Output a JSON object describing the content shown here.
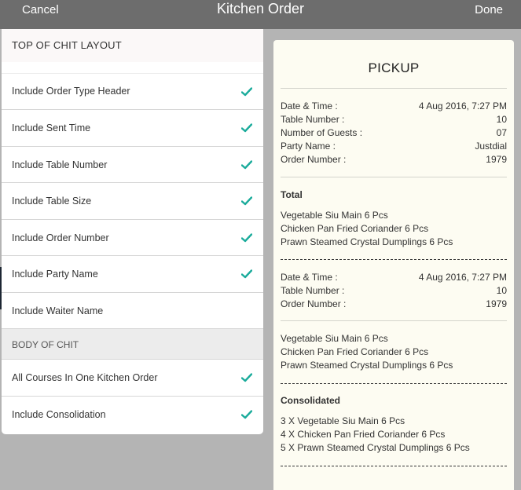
{
  "header": {
    "cancel": "Cancel",
    "title": "Kitchen Order",
    "done": "Done"
  },
  "settings": {
    "top_section": "TOP OF CHIT LAYOUT",
    "top_rows": [
      {
        "label": "Include Order Type Header",
        "checked": true
      },
      {
        "label": "Include Sent Time",
        "checked": true
      },
      {
        "label": "Include Table Number",
        "checked": true
      },
      {
        "label": "Include Table Size",
        "checked": true
      },
      {
        "label": "Include Order Number",
        "checked": true
      },
      {
        "label": "Include Party Name",
        "checked": true
      },
      {
        "label": "Include Waiter Name",
        "checked": false
      }
    ],
    "body_section": "BODY OF CHIT",
    "body_rows": [
      {
        "label": "All Courses In One Kitchen Order",
        "checked": true
      },
      {
        "label": "Include Consolidation",
        "checked": true
      }
    ],
    "check_color": "#1aab9b"
  },
  "preview": {
    "title": "PICKUP",
    "block1": [
      {
        "k": "Date & Time :",
        "v": "4 Aug 2016, 7:27 PM"
      },
      {
        "k": "Table Number :",
        "v": "10"
      },
      {
        "k": "Number of Guests :",
        "v": "07"
      },
      {
        "k": "Party Name :",
        "v": "Justdial"
      },
      {
        "k": "Order Number :",
        "v": "1979"
      }
    ],
    "total_label": "Total",
    "items1": [
      "Vegetable Siu Main 6 Pcs",
      "Chicken Pan Fried Coriander 6 Pcs",
      "Prawn Steamed Crystal Dumplings 6 Pcs"
    ],
    "block2": [
      {
        "k": "Date & Time :",
        "v": "4 Aug 2016, 7:27 PM"
      },
      {
        "k": "Table Number :",
        "v": "10"
      },
      {
        "k": "Order Number :",
        "v": "1979"
      }
    ],
    "items2": [
      "Vegetable Siu Main 6 Pcs",
      "Chicken Pan Fried Coriander 6 Pcs",
      "Prawn Steamed Crystal Dumplings 6 Pcs"
    ],
    "consolidated_label": "Consolidated",
    "consolidated": [
      "3 X Vegetable Siu Main 6 Pcs",
      "4 X Chicken Pan Fried Coriander 6 Pcs",
      "5 X Prawn Steamed Crystal Dumplings 6 Pcs"
    ]
  }
}
